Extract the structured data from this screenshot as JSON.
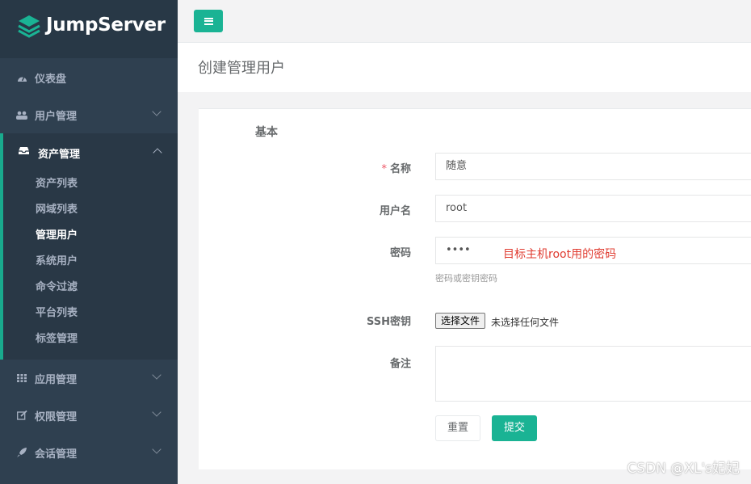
{
  "brand": {
    "name": "JumpServer"
  },
  "sidebar": {
    "items": [
      {
        "label": "仪表盘",
        "icon": "dashboard-icon"
      },
      {
        "label": "用户管理",
        "icon": "users-icon"
      },
      {
        "label": "资产管理",
        "icon": "inbox-icon",
        "expanded": true,
        "children": [
          "资产列表",
          "网域列表",
          "管理用户",
          "系统用户",
          "命令过滤",
          "平台列表",
          "标签管理"
        ],
        "current": "管理用户"
      },
      {
        "label": "应用管理",
        "icon": "th-icon"
      },
      {
        "label": "权限管理",
        "icon": "edit-icon"
      },
      {
        "label": "会话管理",
        "icon": "rocket-icon"
      }
    ]
  },
  "page": {
    "title": "创建管理用户"
  },
  "form": {
    "section": "基本",
    "name": {
      "label": "名称",
      "required": true,
      "value": "随意"
    },
    "username": {
      "label": "用户名",
      "value": "root"
    },
    "password": {
      "label": "密码",
      "value": "••••",
      "help": "密码或密钥密码"
    },
    "annotation": "目标主机root用的密码",
    "ssh_key": {
      "label": "SSH密钥",
      "button": "选择文件",
      "status": "未选择任何文件"
    },
    "comment": {
      "label": "备注",
      "value": ""
    },
    "reset_label": "重置",
    "submit_label": "提交"
  },
  "watermark": "CSDN @XL's妃妃",
  "colors": {
    "sidebar": "#2f4050",
    "accent": "#1ab394",
    "required": "#ed5565",
    "annotation": "#e03c31"
  }
}
